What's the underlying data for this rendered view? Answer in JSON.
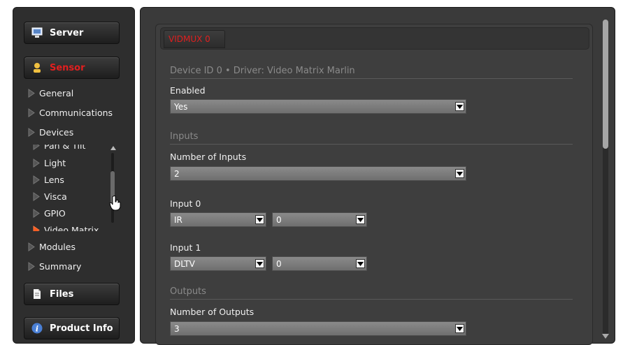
{
  "sidebar": {
    "server_label": "Server",
    "sensor_label": "Sensor",
    "files_label": "Files",
    "product_info_label": "Product Info",
    "items": {
      "general": "General",
      "communications": "Communications",
      "devices": "Devices",
      "modules": "Modules",
      "summary": "Summary"
    },
    "device_items": [
      {
        "label": "Pan & Tilt",
        "active": false
      },
      {
        "label": "Light",
        "active": false
      },
      {
        "label": "Lens",
        "active": false
      },
      {
        "label": "Visca",
        "active": false
      },
      {
        "label": "GPIO",
        "active": false
      },
      {
        "label": "Video Matrix",
        "active": true
      }
    ]
  },
  "tabs": {
    "active_tab": "VIDMUX 0"
  },
  "device": {
    "header": "Device ID 0  •  Driver: Video Matrix Marlin",
    "enabled_label": "Enabled",
    "enabled_value": "Yes"
  },
  "inputs": {
    "section_title": "Inputs",
    "count_label": "Number of Inputs",
    "count_value": "2",
    "input0_label": "Input 0",
    "input0_source": "IR",
    "input0_channel": "0",
    "input1_label": "Input 1",
    "input1_source": "DLTV",
    "input1_channel": "0"
  },
  "outputs": {
    "section_title": "Outputs",
    "count_label": "Number of Outputs",
    "count_value": "3"
  },
  "colors": {
    "accent_red": "#e01f1f",
    "active_arrow": "#ff5a1f",
    "panel": "#3e3e3e",
    "select_bg": "#7d7d7d"
  },
  "icons": {
    "server": "monitor-icon",
    "sensor": "person-icon",
    "files": "document-icon",
    "product_info": "info-icon",
    "nav_arrow": "triangle-right-icon",
    "dropdown": "chevron-down-icon",
    "cursor": "hand-pointer-icon"
  }
}
